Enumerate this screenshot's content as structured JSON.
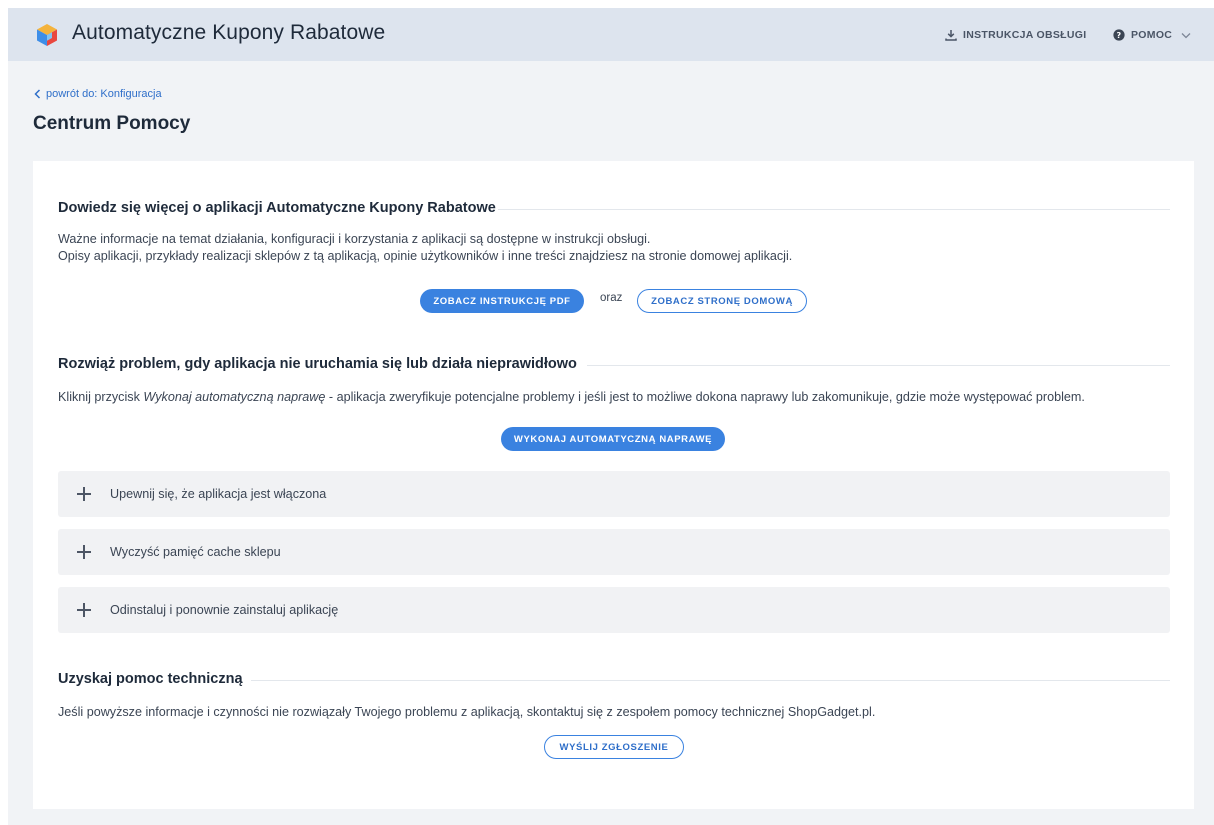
{
  "header": {
    "app_title": "Automatyczne Kupony Rabatowe",
    "manual_label": "INSTRUKCJA OBSŁUGI",
    "help_label": "POMOC"
  },
  "nav": {
    "back_label": "powrót do: Konfiguracja"
  },
  "page": {
    "title": "Centrum Pomocy"
  },
  "learn": {
    "title": "Dowiedz się więcej o aplikacji Automatyczne Kupony Rabatowe",
    "line1": "Ważne informacje na temat działania, konfiguracji i korzystania z aplikacji są dostępne w instrukcji obsługi.",
    "line2": "Opisy aplikacji, przykłady realizacji sklepów z tą aplikacją, opinie użytkowników i inne treści znajdziesz na stronie domowej aplikacji.",
    "pdf_button": "ZOBACZ INSTRUKCJĘ PDF",
    "connector": "oraz",
    "home_button": "ZOBACZ STRONĘ DOMOWĄ"
  },
  "fix": {
    "title": "Rozwiąż problem, gdy aplikacja nie uruchamia się lub działa nieprawidłowo",
    "text_before": "Kliknij przycisk ",
    "text_em": "Wykonaj automatyczną naprawę",
    "text_after": " - aplikacja zweryfikuje potencjalne problemy i jeśli jest to możliwe dokona naprawy lub zakomunikuje, gdzie może występować problem.",
    "repair_button": "WYKONAJ AUTOMATYCZNĄ NAPRAWĘ",
    "accordion": [
      {
        "label": "Upewnij się, że aplikacja jest włączona"
      },
      {
        "label": "Wyczyść pamięć cache sklepu"
      },
      {
        "label": "Odinstaluj i ponownie zainstaluj aplikację"
      }
    ]
  },
  "support": {
    "title": "Uzyskaj pomoc techniczną",
    "text": "Jeśli powyższe informacje i czynności nie rozwiązały Twojego problemu z aplikacją, skontaktuj się z zespołem pomocy technicznej ShopGadget.pl.",
    "send_button": "WYŚLIJ ZGŁOSZENIE"
  },
  "colors": {
    "accent": "#3a82e0",
    "header_bg": "#dde4ee",
    "page_bg": "#f1f3f6"
  },
  "icons": {
    "logo": "cube-logo-icon",
    "manual": "download-icon",
    "help": "question-circle-icon",
    "back": "chevron-left-icon",
    "expand": "plus-icon"
  }
}
